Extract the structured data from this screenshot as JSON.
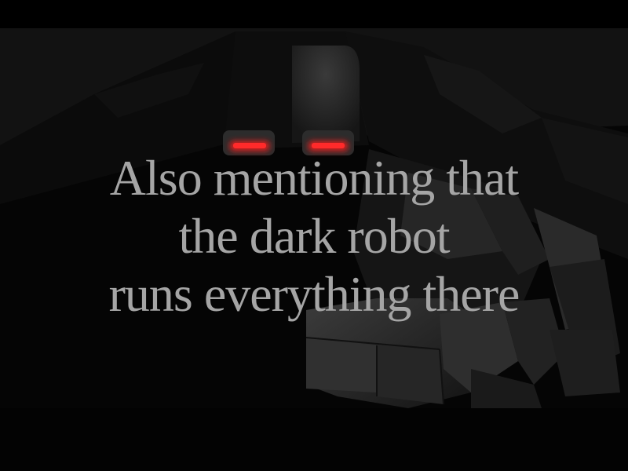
{
  "scene": {
    "caption": {
      "lines": [
        "Also mentioning that",
        "the dark robot",
        "runs everything there"
      ],
      "color": "#a5a5a5"
    },
    "robot": {
      "eye_color": "#ff1a1a",
      "body_color": "#1e1e1e"
    },
    "background_color": "#000000"
  }
}
